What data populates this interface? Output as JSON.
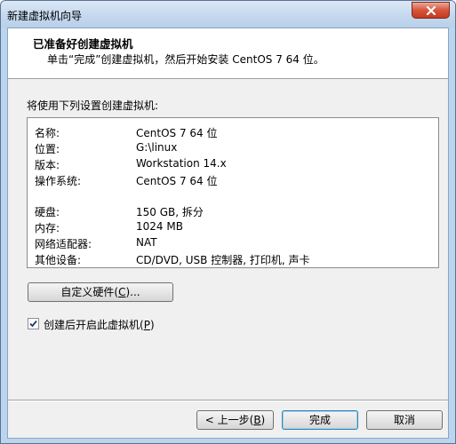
{
  "window": {
    "title": "新建虚拟机向导"
  },
  "header": {
    "title": "已准备好创建虚拟机",
    "subtitle": "单击“完成”创建虚拟机，然后开始安装 CentOS 7 64 位。"
  },
  "main": {
    "intro_label": "将使用下列设置创建虚拟机:",
    "settings": [
      {
        "key": "名称:",
        "value": "CentOS 7 64 位"
      },
      {
        "key": "位置:",
        "value": "G:\\linux"
      },
      {
        "key": "版本:",
        "value": "Workstation 14.x"
      },
      {
        "key": "操作系统:",
        "value": "CentOS 7 64 位"
      },
      {
        "key": "硬盘:",
        "value": "150 GB, 拆分"
      },
      {
        "key": "内存:",
        "value": "1024 MB"
      },
      {
        "key": "网络适配器:",
        "value": "NAT"
      },
      {
        "key": "其他设备:",
        "value": "CD/DVD, USB 控制器, 打印机, 声卡"
      }
    ],
    "customize_button": {
      "prefix": "自定义硬件(",
      "mnemonic": "C",
      "suffix": ")..."
    },
    "power_on_checkbox": {
      "checked": true,
      "prefix": "创建后开启此虚拟机(",
      "mnemonic": "P",
      "suffix": ")"
    }
  },
  "footer": {
    "back_button": {
      "prefix": "< 上一步(",
      "mnemonic": "B",
      "suffix": ")"
    },
    "finish_button": "完成",
    "cancel_button": "取消"
  }
}
